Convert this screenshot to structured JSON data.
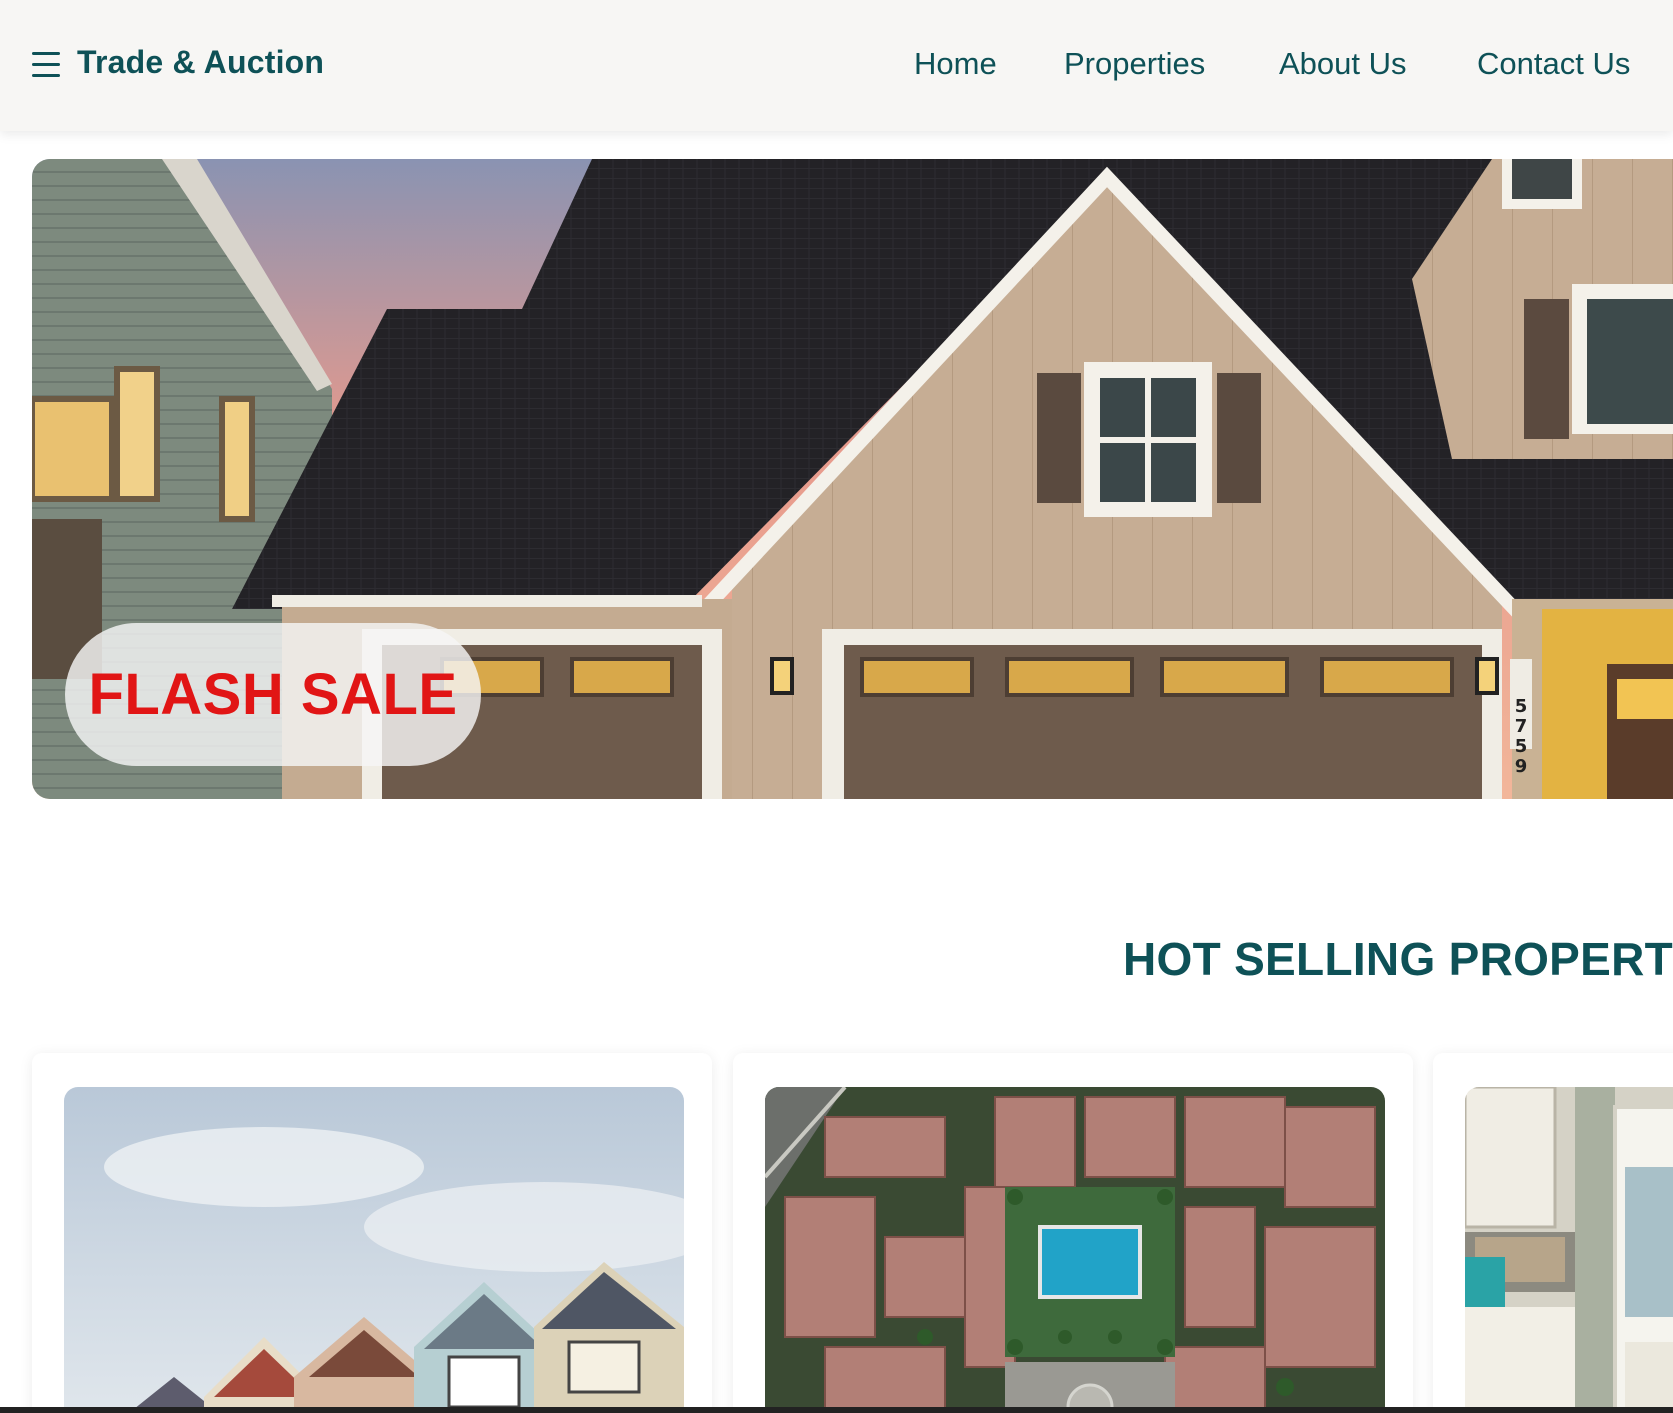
{
  "navbar": {
    "brand": "Trade & Auction",
    "menu_icon": "hamburger-menu-icon",
    "links": [
      "Home",
      "Properties",
      "About Us",
      "Contact Us"
    ]
  },
  "hero": {
    "badge": "FLASH SALE",
    "house_number": "5759"
  },
  "section": {
    "title": "HOT SELLING PROPERTI"
  },
  "colors": {
    "brand": "#0e5157",
    "flash": "#e11515",
    "nav_bg": "#f7f6f4"
  }
}
